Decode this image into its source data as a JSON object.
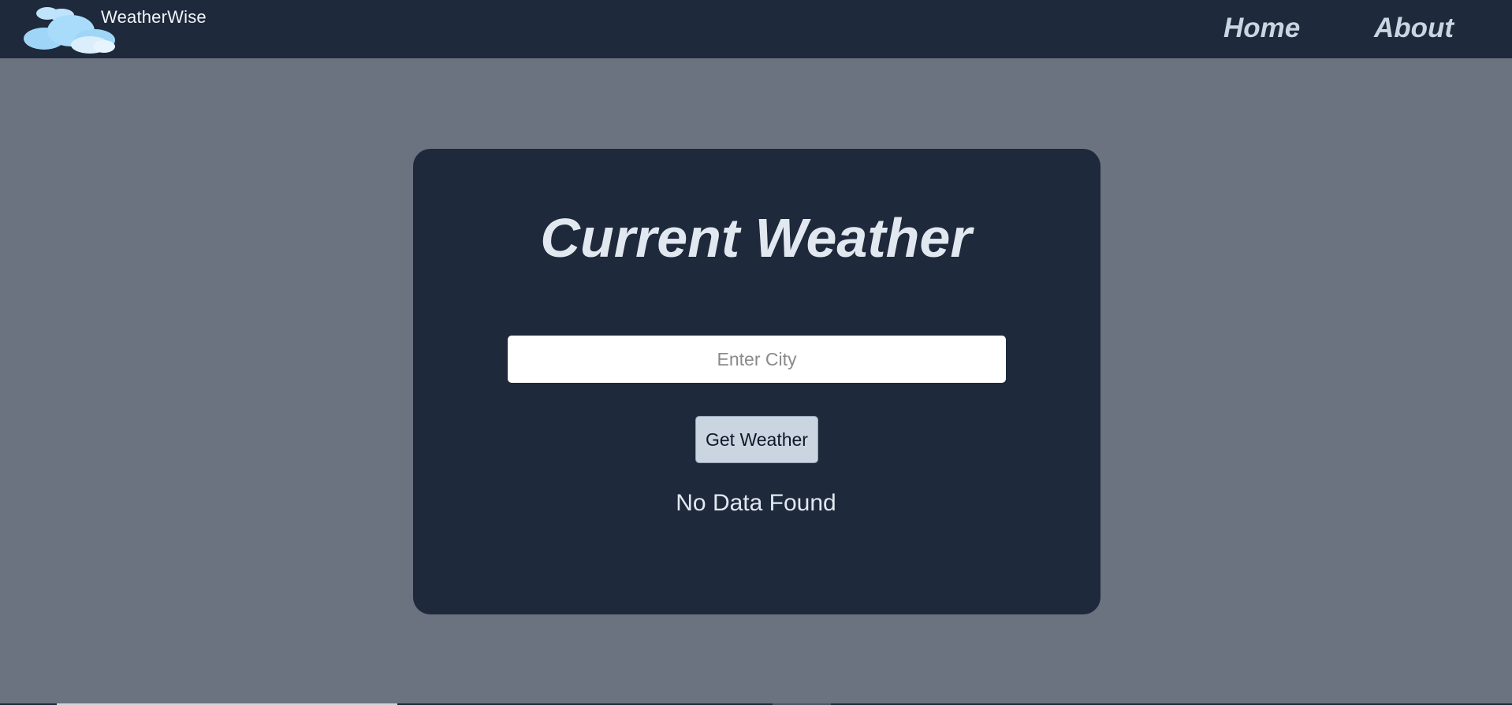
{
  "header": {
    "brand": "WeatherWise",
    "logo_icon": "cloud-icon",
    "nav": [
      {
        "label": "Home"
      },
      {
        "label": "About"
      }
    ]
  },
  "main": {
    "title": "Current Weather",
    "city_input": {
      "value": "",
      "placeholder": "Enter City"
    },
    "button_label": "Get Weather",
    "status_text": "No Data Found"
  },
  "colors": {
    "page_bg": "#6b7280",
    "navbar_bg": "#1e293b",
    "card_bg": "#1e293b",
    "text_light": "#e2e8f0",
    "button_bg": "#cbd5e1"
  }
}
